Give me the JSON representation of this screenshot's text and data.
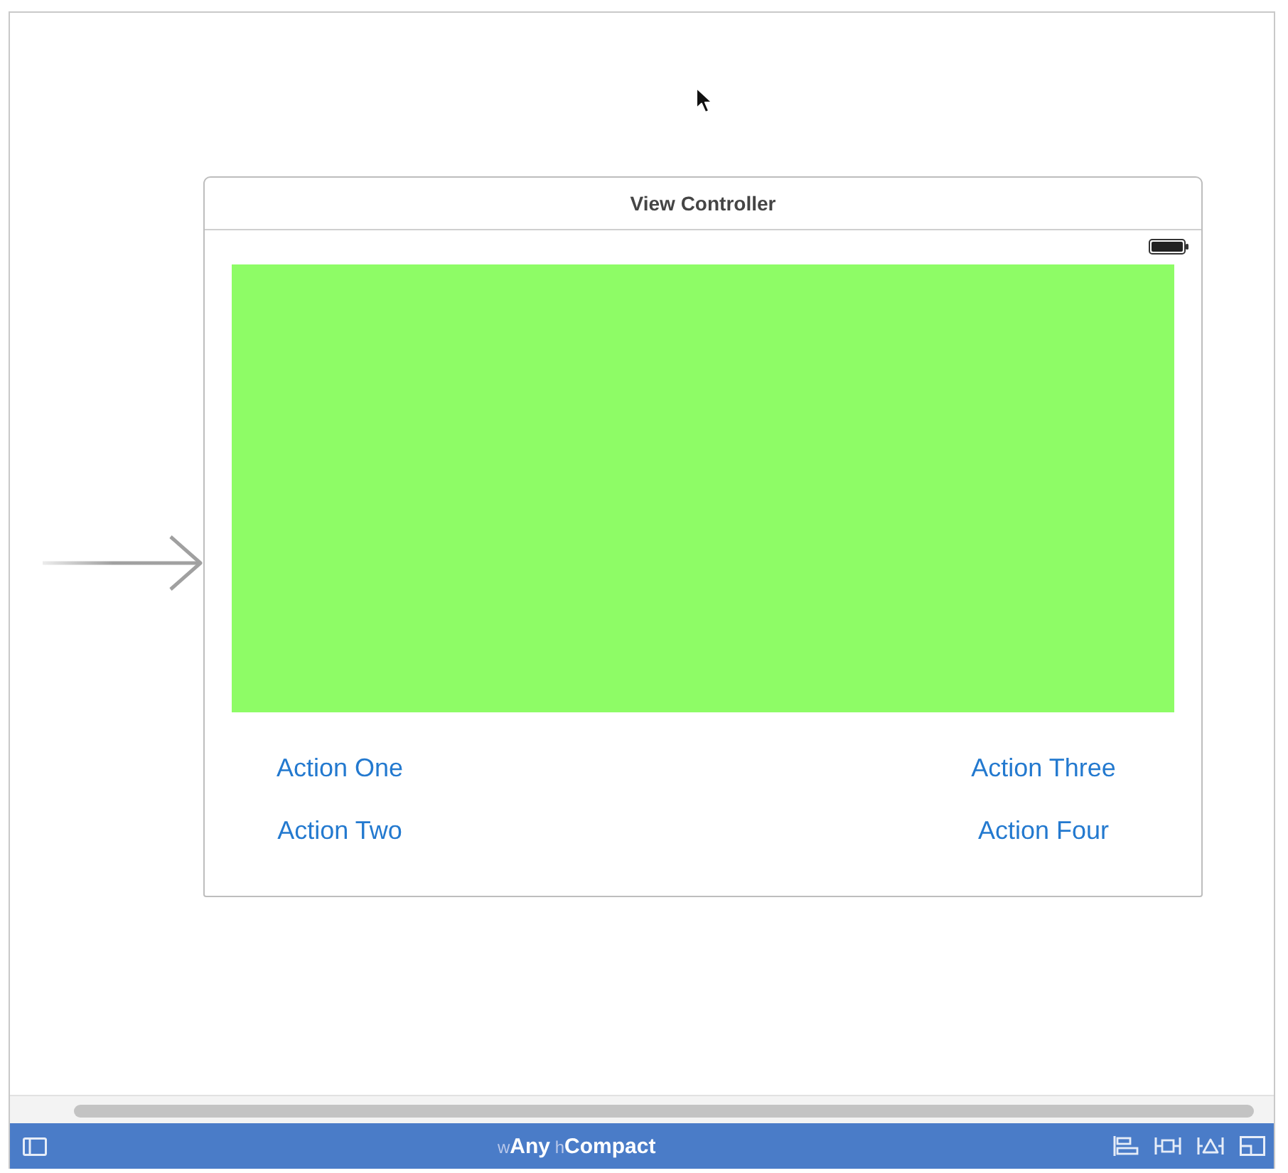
{
  "scene": {
    "title": "View Controller",
    "actions": [
      {
        "label": "Action One"
      },
      {
        "label": "Action Three"
      },
      {
        "label": "Action Two"
      },
      {
        "label": "Action Four"
      }
    ]
  },
  "bottom_bar": {
    "size_class": "w**Any** h**Compact**"
  }
}
